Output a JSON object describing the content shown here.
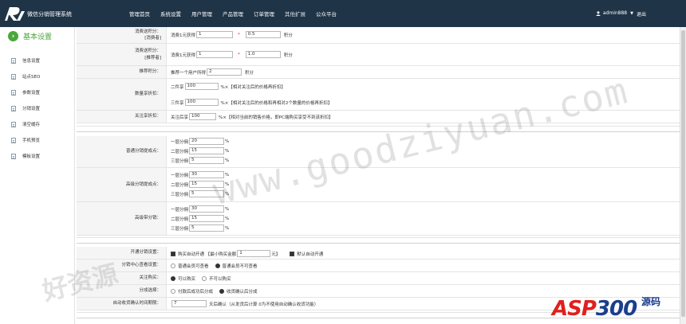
{
  "header": {
    "app_title": "微信分销管理系统",
    "nav": [
      "管理首页",
      "系统设置",
      "用户管理",
      "产品管理",
      "订单管理",
      "其他扩展",
      "公众平台"
    ],
    "user": "admin888",
    "logout": "退出"
  },
  "sidebar": {
    "title": "基本设置",
    "items": [
      "信息设置",
      "站点SEO",
      "参数设置",
      "分销设置",
      "清空缓存",
      "手机预览",
      "模板设置"
    ]
  },
  "form": {
    "consume_points_consumer": {
      "label1": "消费送积分：",
      "label2": "[消费者]",
      "prefix": "消费1元获得",
      "amount": "1",
      "op": "*",
      "rate": "0.5",
      "unit": "积分"
    },
    "consume_points_referrer": {
      "label1": "消费送积分：",
      "label2": "[推荐者]",
      "prefix": "消费1元获得",
      "amount": "1",
      "op": "*",
      "rate": "1.0",
      "unit": "积分"
    },
    "recommend_points": {
      "label": "推荐积分：",
      "prefix": "推荐一个用户所得",
      "value": "2",
      "unit": "积分"
    },
    "quantity_discount": {
      "label": "数量享折扣：",
      "lines": [
        {
          "prefix": "二件享",
          "value": "100",
          "note": "%×【相对关注后的价格再折扣】"
        },
        {
          "prefix": "三件享",
          "value": "100",
          "note": "%×【相对关注后的价格和再相对2个数量的价格再折扣】"
        }
      ]
    },
    "follow_discount": {
      "label": "关注享折扣：",
      "prefix": "关注后享",
      "value": "100",
      "note": "%×【相对当前的销售价格，即PC端购买享受不到该折扣】"
    },
    "normal_rebate": {
      "label": "普通分销提成点：",
      "lines": [
        {
          "prefix": "一层分佣",
          "value": "20",
          "unit": "%"
        },
        {
          "prefix": "二层分佣",
          "value": "15",
          "unit": "%"
        },
        {
          "prefix": "三层分佣",
          "value": "5",
          "unit": "%"
        }
      ]
    },
    "senior_rebate": {
      "label": "高级分销提成点：",
      "lines": [
        {
          "prefix": "一层分佣",
          "value": "30",
          "unit": "%"
        },
        {
          "prefix": "二层分佣",
          "value": "15",
          "unit": "%"
        },
        {
          "prefix": "三层分佣",
          "value": "5",
          "unit": "%"
        }
      ]
    },
    "top_rebate": {
      "label": "高级带分销：",
      "lines": [
        {
          "prefix": "一层分佣",
          "value": "30",
          "unit": "%"
        },
        {
          "prefix": "二层分佣",
          "value": "15",
          "unit": "%"
        },
        {
          "prefix": "三层分佣",
          "value": "5",
          "unit": "%"
        }
      ]
    },
    "open_distribution": {
      "label": "开通分销设置：",
      "auto_text": "购买自动开通 【最小购买金额",
      "min_amount": "1",
      "yuan": "元】",
      "default_text": "默认自动开通"
    },
    "center_view": {
      "label": "分销中心查看设置：",
      "opt1": "普通会员可查看",
      "opt2": "普通会员不可查看"
    },
    "follow_buy": {
      "label": "关注购买：",
      "opt1": "可以购买",
      "opt2": "不可以购买"
    },
    "rebate_select": {
      "label": "分成选择：",
      "opt1": "付款后成功后分成",
      "opt2": "收货确认后分成"
    },
    "auto_confirm": {
      "label": "自动收货确认时间期限：",
      "value": "7",
      "note": "天后确认（从发货后计算 0为不使用自动确认收货功能）"
    }
  },
  "watermark": {
    "main": "www.goodziyuan.com",
    "left": "好资源",
    "brand_a": "ASP",
    "brand_b": "300",
    "brand_cn": "源码"
  }
}
